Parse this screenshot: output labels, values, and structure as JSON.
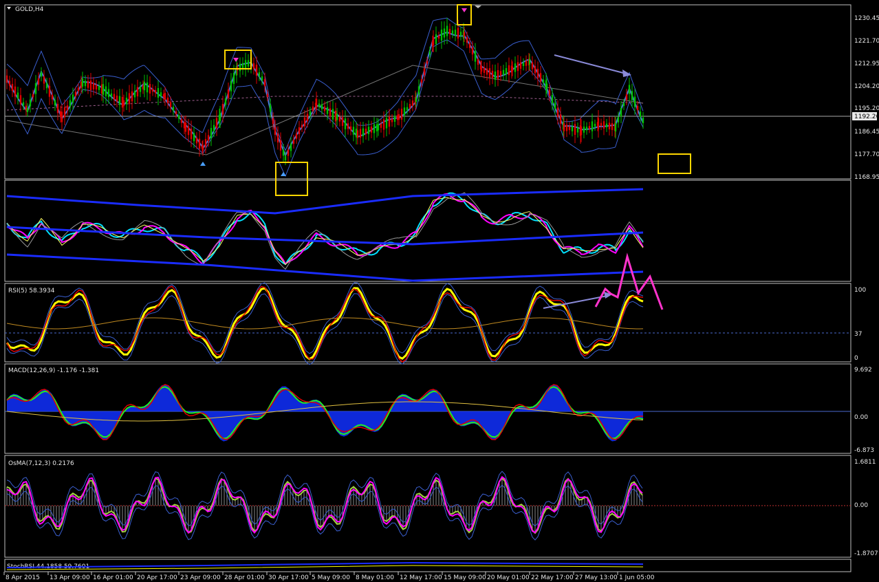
{
  "window": {
    "symbol_title": "GOLD,H4"
  },
  "price_panel": {
    "current_price": "1192.26",
    "axis_labels": [
      "1230.45",
      "1221.70",
      "1212.95",
      "1204.20",
      "1195.20",
      "1186.45",
      "1177.70",
      "1168.95"
    ]
  },
  "osc_panel": {
    "title": ""
  },
  "rsi_panel": {
    "title": "RSI(5) 58.3934",
    "axis_labels": [
      "100",
      "37",
      "0"
    ]
  },
  "macd_panel": {
    "title": "MACD(12,26,9) -1.176 -1.381",
    "axis_labels": [
      "9.692",
      "0.00",
      "-6.873"
    ]
  },
  "osma_panel": {
    "title": "OsMA(7,12,3) 0.2176",
    "axis_labels": [
      "1.6811",
      "0.00",
      "-1.8707"
    ]
  },
  "stoch_panel": {
    "title": "StochRSI 44.1858 59.7601"
  },
  "time_axis": [
    "8 Apr 2015",
    "13 Apr 09:00",
    "16 Apr 01:00",
    "20 Apr 17:00",
    "23 Apr 09:00",
    "28 Apr 01:00",
    "30 Apr 17:00",
    "5 May 09:00",
    "8 May 01:00",
    "12 May 17:00",
    "15 May 09:00",
    "20 May 01:00",
    "22 May 17:00",
    "27 May 13:00",
    "1 Jun 05:00"
  ],
  "colors": {
    "background": "#000000",
    "grid_border": "#c0c0c0",
    "bull": "#00c000",
    "bear": "#e00000",
    "band": "#3a5fd0",
    "rsi_main": "#ffff00",
    "signal": "#ff00ff",
    "cyan": "#00e0ff",
    "highlight_box": "#ffd700",
    "annotation_magenta": "#ff33cc",
    "trend_arrow": "#8a8ad8"
  }
}
